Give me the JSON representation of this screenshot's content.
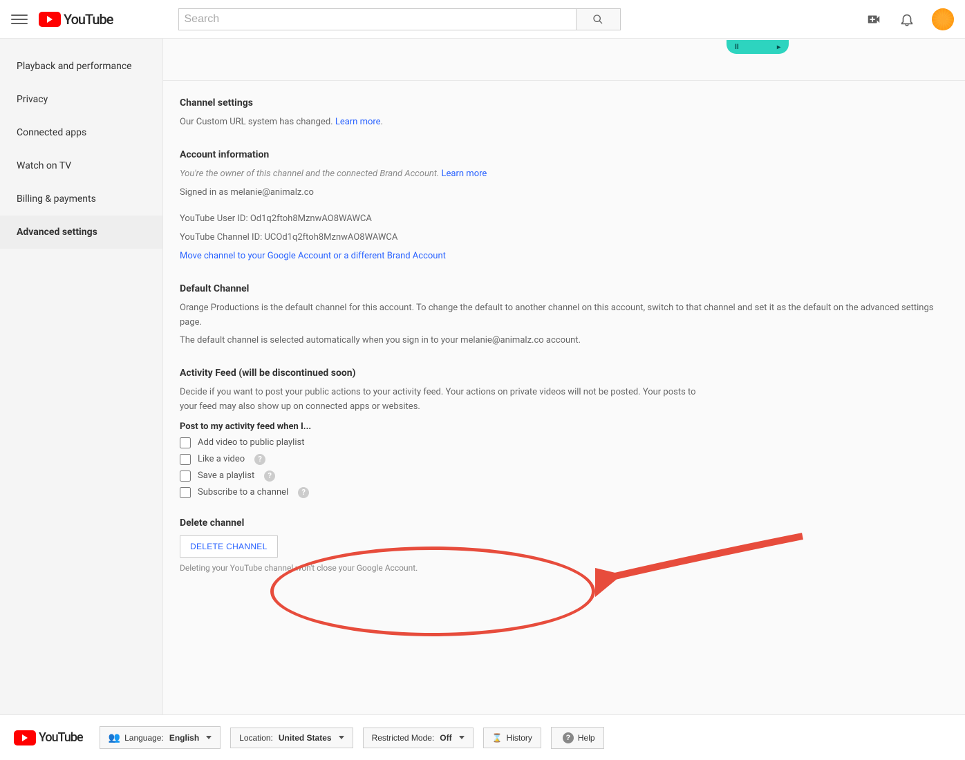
{
  "header": {
    "logo_text": "YouTube",
    "search_placeholder": "Search"
  },
  "sidebar": {
    "items": [
      {
        "label": "Playback and performance"
      },
      {
        "label": "Privacy"
      },
      {
        "label": "Connected apps"
      },
      {
        "label": "Watch on TV"
      },
      {
        "label": "Billing & payments"
      },
      {
        "label": "Advanced settings"
      }
    ]
  },
  "content": {
    "channel_settings": {
      "title": "Channel settings",
      "text": "Our Custom URL system has changed. ",
      "link": "Learn more"
    },
    "account_info": {
      "title": "Account information",
      "owner_text": "You're the owner of this channel and the connected Brand Account. ",
      "learn_more": "Learn more",
      "signed_in": "Signed in as melanie@animalz.co",
      "user_id": "YouTube User ID: Od1q2ftoh8MznwAO8WAWCA",
      "channel_id": "YouTube Channel ID: UCOd1q2ftoh8MznwAO8WAWCA",
      "move_link": "Move channel to your Google Account or a different Brand Account"
    },
    "default_channel": {
      "title": "Default Channel",
      "p1": "Orange Productions is the default channel for this account. To change the default to another channel on this account, switch to that channel and set it as the default on the advanced settings page.",
      "p2": "The default channel is selected automatically when you sign in to your melanie@animalz.co account."
    },
    "activity_feed": {
      "title": "Activity Feed (will be discontinued soon)",
      "desc": "Decide if you want to post your public actions to your activity feed. Your actions on private videos will not be posted. Your posts to your feed may also show up on connected apps or websites.",
      "sub": "Post to my activity feed when I...",
      "opts": [
        {
          "label": "Add video to public playlist",
          "help": false
        },
        {
          "label": "Like a video",
          "help": true
        },
        {
          "label": "Save a playlist",
          "help": true
        },
        {
          "label": "Subscribe to a channel",
          "help": true
        }
      ]
    },
    "delete_channel": {
      "title": "Delete channel",
      "button": "DELETE CHANNEL",
      "disclaimer": "Deleting your YouTube channel won't close your Google Account."
    }
  },
  "footer": {
    "language_label": "Language: ",
    "language_value": "English",
    "location_label": "Location: ",
    "location_value": "United States",
    "restricted_label": "Restricted Mode: ",
    "restricted_value": "Off",
    "history": "History",
    "help": "Help"
  }
}
